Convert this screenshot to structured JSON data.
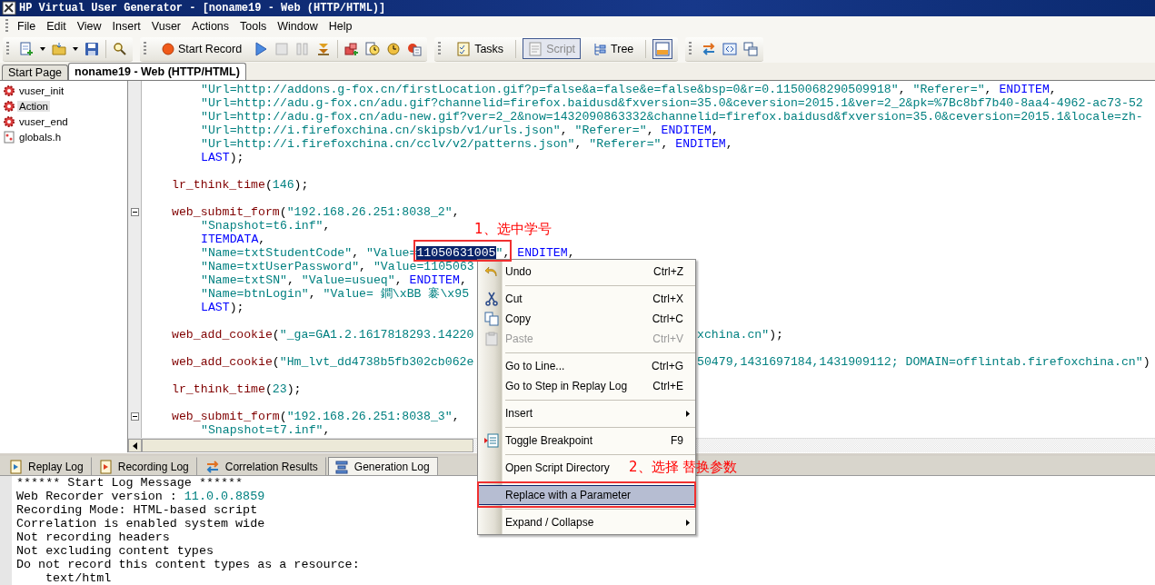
{
  "window": {
    "title": "HP Virtual User Generator - [noname19 - Web (HTTP/HTML)]"
  },
  "menu_bar": [
    "File",
    "Edit",
    "View",
    "Insert",
    "Vuser",
    "Actions",
    "Tools",
    "Window",
    "Help"
  ],
  "toolbar": {
    "start_record": "Start Record",
    "tasks": "Tasks",
    "script": {
      "label": "Script",
      "selected": true
    },
    "tree": {
      "label": "Tree",
      "selected": false
    },
    "panel_toggle": {
      "selected": true
    }
  },
  "document_tabs": [
    {
      "label": "Start Page",
      "selected": false
    },
    {
      "label": "noname19 - Web (HTTP/HTML)",
      "selected": true
    }
  ],
  "script_tree": [
    {
      "label": "vuser_init",
      "kind": "action",
      "selected": false
    },
    {
      "label": "Action",
      "kind": "action",
      "selected": true
    },
    {
      "label": "vuser_end",
      "kind": "action",
      "selected": false
    },
    {
      "label": "globals.h",
      "kind": "header",
      "selected": false
    }
  ],
  "editor": {
    "lines": [
      {
        "kind": "continuation",
        "tokens": [
          {
            "kind": "str",
            "text": "\"Url=http://addons.g-fox.cn/firstLocation.gif?p=false&a=false&e=false&bsp=0&r=0.1150068290509918\""
          },
          {
            "kind": "plain",
            "text": ", "
          },
          {
            "kind": "str",
            "text": "\"Referer=\""
          },
          {
            "kind": "plain",
            "text": ", "
          },
          {
            "kind": "kw",
            "text": "ENDITEM"
          },
          {
            "kind": "plain",
            "text": ","
          }
        ]
      },
      {
        "kind": "continuation",
        "tokens": [
          {
            "kind": "str",
            "text": "\"Url=http://adu.g-fox.cn/adu.gif?channelid=firefox.baidusd&fxversion=35.0&ceversion=2015.1&ver=2_2&pk=%7Bc8bf7b40-8aa4-4962-ac73-52"
          }
        ]
      },
      {
        "kind": "continuation",
        "tokens": [
          {
            "kind": "str",
            "text": "\"Url=http://adu.g-fox.cn/adu-new.gif?ver=2_2&now=1432090863332&channelid=firefox.baidusd&fxversion=35.0&ceversion=2015.1&locale=zh-"
          }
        ]
      },
      {
        "kind": "continuation",
        "tokens": [
          {
            "kind": "str",
            "text": "\"Url=http://i.firefoxchina.cn/skipsb/v1/urls.json\""
          },
          {
            "kind": "plain",
            "text": ", "
          },
          {
            "kind": "str",
            "text": "\"Referer=\""
          },
          {
            "kind": "plain",
            "text": ", "
          },
          {
            "kind": "kw",
            "text": "ENDITEM"
          },
          {
            "kind": "plain",
            "text": ","
          }
        ]
      },
      {
        "kind": "continuation",
        "tokens": [
          {
            "kind": "str",
            "text": "\"Url=http://i.firefoxchina.cn/cclv/v2/patterns.json\""
          },
          {
            "kind": "plain",
            "text": ", "
          },
          {
            "kind": "str",
            "text": "\"Referer=\""
          },
          {
            "kind": "plain",
            "text": ", "
          },
          {
            "kind": "kw",
            "text": "ENDITEM"
          },
          {
            "kind": "plain",
            "text": ","
          }
        ]
      },
      {
        "kind": "continuation",
        "tokens": [
          {
            "kind": "kw",
            "text": "LAST"
          },
          {
            "kind": "plain",
            "text": ");"
          }
        ]
      },
      {
        "kind": "blank"
      },
      {
        "kind": "statement",
        "tokens": [
          {
            "kind": "fn",
            "text": "lr_think_time"
          },
          {
            "kind": "plain",
            "text": "("
          },
          {
            "kind": "num",
            "text": "146"
          },
          {
            "kind": "plain",
            "text": ");"
          }
        ]
      },
      {
        "kind": "blank"
      },
      {
        "kind": "statement",
        "expanded": true,
        "tokens": [
          {
            "kind": "fn",
            "text": "web_submit_form"
          },
          {
            "kind": "plain",
            "text": "("
          },
          {
            "kind": "str",
            "text": "\"192.168.26.251:8038_2\""
          },
          {
            "kind": "plain",
            "text": ","
          }
        ]
      },
      {
        "kind": "continuation",
        "tokens": [
          {
            "kind": "str",
            "text": "\"Snapshot=t6.inf\""
          },
          {
            "kind": "plain",
            "text": ","
          }
        ]
      },
      {
        "kind": "continuation",
        "tokens": [
          {
            "kind": "kw",
            "text": "ITEMDATA"
          },
          {
            "kind": "plain",
            "text": ","
          }
        ]
      },
      {
        "kind": "continuation",
        "tokens": [
          {
            "kind": "str",
            "text": "\"Name=txtStudentCode\""
          },
          {
            "kind": "plain",
            "text": ", "
          },
          {
            "kind": "str",
            "text": "\"Value="
          },
          {
            "kind": "selected",
            "text": "11050631005"
          },
          {
            "kind": "str",
            "text": "\""
          },
          {
            "kind": "plain",
            "text": ", "
          },
          {
            "kind": "kw",
            "text": "ENDITEM"
          },
          {
            "kind": "plain",
            "text": ","
          }
        ]
      },
      {
        "kind": "continuation",
        "tokens": [
          {
            "kind": "str",
            "text": "\"Name=txtUserPassword\""
          },
          {
            "kind": "plain",
            "text": ", "
          },
          {
            "kind": "str",
            "text": "\"Value=1105063"
          }
        ]
      },
      {
        "kind": "continuation",
        "tokens": [
          {
            "kind": "str",
            "text": "\"Name=txtSN\""
          },
          {
            "kind": "plain",
            "text": ", "
          },
          {
            "kind": "str",
            "text": "\"Value=usueq\""
          },
          {
            "kind": "plain",
            "text": ", "
          },
          {
            "kind": "kw",
            "text": "ENDITEM"
          },
          {
            "kind": "plain",
            "text": ","
          }
        ]
      },
      {
        "kind": "continuation",
        "tokens": [
          {
            "kind": "str",
            "text": "\"Name=btnLogin\""
          },
          {
            "kind": "plain",
            "text": ", "
          },
          {
            "kind": "str",
            "text": "\"Value= 鐧\\xBB 褰\\x95"
          }
        ]
      },
      {
        "kind": "continuation",
        "tokens": [
          {
            "kind": "kw",
            "text": "LAST"
          },
          {
            "kind": "plain",
            "text": ");"
          }
        ]
      },
      {
        "kind": "blank"
      },
      {
        "kind": "statement",
        "tokens": [
          {
            "kind": "fn",
            "text": "web_add_cookie"
          },
          {
            "kind": "plain",
            "text": "("
          },
          {
            "kind": "str",
            "text": "\"_ga=GA1.2.1617818293.14220"
          }
        ],
        "tail": [
          {
            "kind": "str",
            "text": "xchina.cn\""
          },
          {
            "kind": "plain",
            "text": ");"
          }
        ]
      },
      {
        "kind": "blank"
      },
      {
        "kind": "statement",
        "tokens": [
          {
            "kind": "fn",
            "text": "web_add_cookie"
          },
          {
            "kind": "plain",
            "text": "("
          },
          {
            "kind": "str",
            "text": "\"Hm_lvt_dd4738b5fb302cb062e"
          }
        ],
        "tail": [
          {
            "kind": "str",
            "text": "50479,1431697184,1431909112; DOMAIN=offlintab.firefoxchina.cn\""
          },
          {
            "kind": "plain",
            "text": ")"
          }
        ]
      },
      {
        "kind": "blank"
      },
      {
        "kind": "statement",
        "tokens": [
          {
            "kind": "fn",
            "text": "lr_think_time"
          },
          {
            "kind": "plain",
            "text": "("
          },
          {
            "kind": "num",
            "text": "23"
          },
          {
            "kind": "plain",
            "text": ");"
          }
        ]
      },
      {
        "kind": "blank"
      },
      {
        "kind": "statement",
        "expanded": true,
        "tokens": [
          {
            "kind": "fn",
            "text": "web_submit_form"
          },
          {
            "kind": "plain",
            "text": "("
          },
          {
            "kind": "str",
            "text": "\"192.168.26.251:8038_3\""
          },
          {
            "kind": "plain",
            "text": ","
          }
        ]
      },
      {
        "kind": "continuation",
        "tokens": [
          {
            "kind": "str",
            "text": "\"Snapshot=t7.inf\""
          },
          {
            "kind": "plain",
            "text": ","
          }
        ]
      }
    ]
  },
  "context_menu": {
    "items": [
      {
        "kind": "item",
        "label": "Undo",
        "shortcut": "Ctrl+Z",
        "disabled": false,
        "selected": false,
        "submenu": false
      },
      {
        "kind": "separator"
      },
      {
        "kind": "item",
        "label": "Cut",
        "shortcut": "Ctrl+X",
        "disabled": false,
        "selected": false,
        "submenu": false
      },
      {
        "kind": "item",
        "label": "Copy",
        "shortcut": "Ctrl+C",
        "disabled": false,
        "selected": false,
        "submenu": false
      },
      {
        "kind": "item",
        "label": "Paste",
        "shortcut": "Ctrl+V",
        "disabled": true,
        "selected": false,
        "submenu": false
      },
      {
        "kind": "separator"
      },
      {
        "kind": "item",
        "label": "Go to Line...",
        "shortcut": "Ctrl+G",
        "disabled": false,
        "selected": false,
        "submenu": false
      },
      {
        "kind": "item",
        "label": "Go to Step in Replay Log",
        "shortcut": "Ctrl+E",
        "disabled": false,
        "selected": false,
        "submenu": false
      },
      {
        "kind": "separator"
      },
      {
        "kind": "item",
        "label": "Insert",
        "disabled": false,
        "selected": false,
        "submenu": true
      },
      {
        "kind": "separator"
      },
      {
        "kind": "item",
        "label": "Toggle Breakpoint",
        "shortcut": "F9",
        "disabled": false,
        "selected": false,
        "submenu": false
      },
      {
        "kind": "separator"
      },
      {
        "kind": "item",
        "label": "Open Script Directory",
        "disabled": false,
        "selected": false,
        "submenu": false
      },
      {
        "kind": "separator"
      },
      {
        "kind": "item",
        "label": "Replace with a Parameter",
        "disabled": false,
        "selected": true,
        "submenu": false
      },
      {
        "kind": "separator"
      },
      {
        "kind": "item",
        "label": "Expand / Collapse",
        "disabled": false,
        "selected": false,
        "submenu": true
      }
    ]
  },
  "bottom_tabs": [
    {
      "label": "Replay Log",
      "selected": false
    },
    {
      "label": "Recording Log",
      "selected": false
    },
    {
      "label": "Correlation Results",
      "selected": false
    },
    {
      "label": "Generation Log",
      "selected": true
    }
  ],
  "log": {
    "lines": [
      {
        "kind": "plain",
        "tokens": [
          {
            "kind": "plain",
            "text": "****** Start Log Message ******"
          }
        ]
      },
      {
        "kind": "plain",
        "tokens": [
          {
            "kind": "plain",
            "text": "Web Recorder version : "
          },
          {
            "kind": "num",
            "text": "11.0.0.8859"
          }
        ]
      },
      {
        "kind": "plain",
        "tokens": [
          {
            "kind": "plain",
            "text": "Recording Mode: HTML-based script"
          }
        ]
      },
      {
        "kind": "plain",
        "tokens": [
          {
            "kind": "plain",
            "text": "Correlation is enabled system wide"
          }
        ]
      },
      {
        "kind": "plain",
        "tokens": [
          {
            "kind": "plain",
            "text": "Not recording headers"
          }
        ]
      },
      {
        "kind": "plain",
        "tokens": [
          {
            "kind": "plain",
            "text": "Not excluding content types"
          }
        ]
      },
      {
        "kind": "plain",
        "tokens": [
          {
            "kind": "plain",
            "text": "Do not record this content types as a resource:"
          }
        ]
      },
      {
        "kind": "indented",
        "tokens": [
          {
            "kind": "plain",
            "text": "text/html"
          }
        ]
      }
    ]
  },
  "callouts": [
    {
      "text": "1、选中学号"
    },
    {
      "text": "2、选择 替换参数"
    }
  ]
}
